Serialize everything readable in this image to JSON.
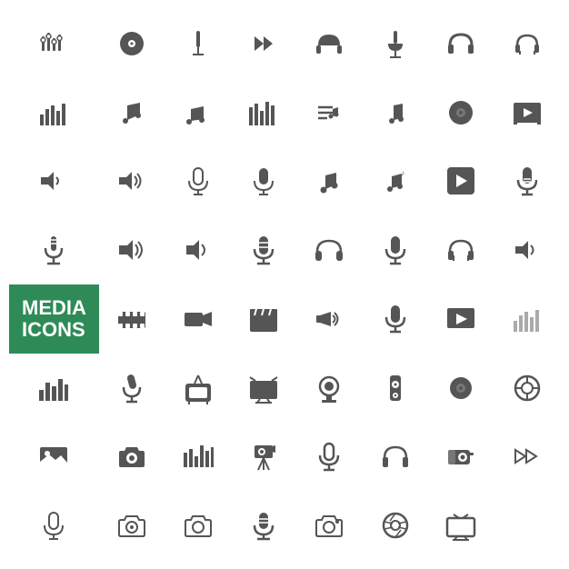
{
  "label": {
    "line1": "MEDIA",
    "line2": "ICONS"
  },
  "colors": {
    "icon_dark": "#555555",
    "icon_light": "#aaaaaa",
    "label_bg": "#2e8b57",
    "label_text": "#ffffff",
    "bg": "#ffffff"
  }
}
